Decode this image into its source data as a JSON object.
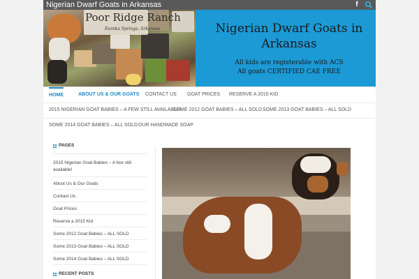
{
  "site": {
    "title": "Nigerian Dwarf Goats in Arkansas",
    "accent_color": "#1e88c7",
    "topbar_color": "#595959",
    "banner_color": "#1b9ad6"
  },
  "social": [
    {
      "icon": "facebook-icon",
      "glyph": "f"
    },
    {
      "icon": "search-icon"
    }
  ],
  "header": {
    "logo_title": "Poor Ridge Ranch",
    "logo_subtitle": "Eureka Springs, Arkansas",
    "banner_title": "Nigerian Dwarf Goats in Arkansas",
    "banner_line1": "All kids are registerable with ACS",
    "banner_line2": "All goats CERTIFIED CAE FREE"
  },
  "nav": {
    "items": [
      {
        "label": "Home",
        "active": true
      },
      {
        "label": "About Us & Our Goats"
      },
      {
        "label": "Contact Us"
      },
      {
        "label": "Goat Prices"
      },
      {
        "label": "Reserve a 2015 Kid"
      },
      {
        "label": "2015 Nigerian Goat Babies – A few still available!"
      },
      {
        "label": "Some 2012 Goat Babies – ALL SOLD"
      },
      {
        "label": "Some 2013 Goat Babies – ALL SOLD"
      },
      {
        "label": "Some 2014 Goat Babies – ALL SOLD"
      },
      {
        "label": "Our Handmade Soap"
      }
    ]
  },
  "sidebar": {
    "pages_title": "Pages",
    "pages": [
      "2015 Nigerian Goat Babies – A few still available!",
      "About Us & Our Goats",
      "Contact Us",
      "Goat Prices",
      "Reserve a 2015 Kid",
      "Some 2012 Goat Babies – ALL SOLD",
      "Some 2013 Goat Babies – ALL SOLD",
      "Some 2014 Goat Babies – ALL SOLD"
    ],
    "recent_title": "Recent Posts"
  }
}
